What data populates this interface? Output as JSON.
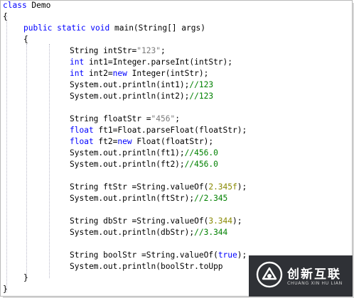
{
  "code": {
    "l1": [
      "class",
      " Demo"
    ],
    "l2": "{",
    "l3": [
      "public static void",
      " main(String[] args)"
    ],
    "l4": "{",
    "l5": [
      "String intStr=",
      "\"123\"",
      ";"
    ],
    "l6": [
      "int",
      " int1=Integer.parseInt(intStr);"
    ],
    "l7": [
      "int",
      " int2=",
      "new",
      " Integer(intStr);"
    ],
    "l8": [
      "System.out.println(int1);",
      "//123"
    ],
    "l9": [
      "System.out.println(int2);",
      "//123"
    ],
    "l10": [
      "String floatStr =",
      "\"456\"",
      ";"
    ],
    "l11": [
      "float",
      " ft1=Float.parseFloat(floatStr);"
    ],
    "l12": [
      "float",
      " ft2=",
      "new",
      " Float(floatStr);"
    ],
    "l13": [
      "System.out.println(ft1);",
      "//456.0"
    ],
    "l14": [
      "System.out.println(ft2);",
      "//456.0"
    ],
    "l15": [
      "String ftStr =String.valueOf(",
      "2.345f",
      ");"
    ],
    "l16": [
      "System.out.println(ftStr);",
      "//2.345"
    ],
    "l17": [
      "String dbStr =String.valueOf(",
      "3.344",
      ");"
    ],
    "l18": [
      "System.out.println(dbStr);",
      "//3.344"
    ],
    "l19": [
      "String boolStr =String.valueOf(",
      "true",
      ");"
    ],
    "l20": "System.out.println(boolStr.toUpp",
    "l21": "}",
    "l22": "}"
  },
  "watermark": {
    "title": "创新互联",
    "subtitle": "CHUANG XIN HU LIAN"
  },
  "colors": {
    "keyword": "#0000ff",
    "string": "#7b7b7b",
    "comment": "#008000",
    "number": "#888800",
    "watermark_bg": "#2f3136"
  }
}
